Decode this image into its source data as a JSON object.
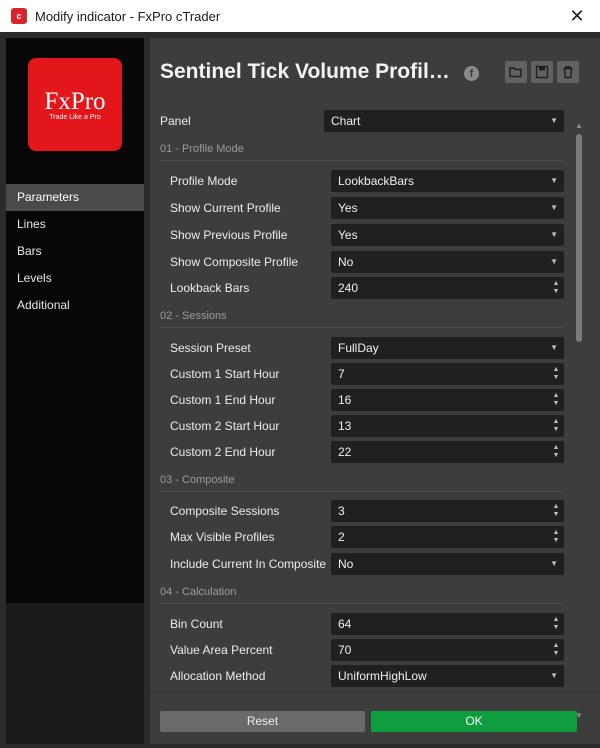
{
  "window": {
    "title": "Modify indicator - FxPro cTrader",
    "close_glyph": "✕"
  },
  "sidebar": {
    "logo_text": "FxPro",
    "logo_tagline": "Trade Like a Pro",
    "items": [
      {
        "label": "Parameters",
        "active": true
      },
      {
        "label": "Lines",
        "active": false
      },
      {
        "label": "Bars",
        "active": false
      },
      {
        "label": "Levels",
        "active": false
      },
      {
        "label": "Additional",
        "active": false
      }
    ]
  },
  "header": {
    "title": "Sentinel Tick Volume Profil…",
    "icons": [
      "facebook-icon",
      "open-folder-icon",
      "save-icon",
      "trash-icon"
    ]
  },
  "params": {
    "panel": {
      "label": "Panel",
      "value": "Chart"
    },
    "sections": [
      {
        "title": "01 - Profile Mode",
        "rows": [
          {
            "label": "Profile Mode",
            "value": "LookbackBars",
            "type": "select"
          },
          {
            "label": "Show Current Profile",
            "value": "Yes",
            "type": "select"
          },
          {
            "label": "Show Previous Profile",
            "value": "Yes",
            "type": "select"
          },
          {
            "label": "Show Composite Profile",
            "value": "No",
            "type": "select"
          },
          {
            "label": "Lookback Bars",
            "value": "240",
            "type": "number"
          }
        ]
      },
      {
        "title": "02 - Sessions",
        "rows": [
          {
            "label": "Session Preset",
            "value": "FullDay",
            "type": "select"
          },
          {
            "label": "Custom 1 Start Hour",
            "value": "7",
            "type": "number"
          },
          {
            "label": "Custom 1 End Hour",
            "value": "16",
            "type": "number"
          },
          {
            "label": "Custom 2 Start Hour",
            "value": "13",
            "type": "number"
          },
          {
            "label": "Custom 2 End Hour",
            "value": "22",
            "type": "number"
          }
        ]
      },
      {
        "title": "03 - Composite",
        "rows": [
          {
            "label": "Composite Sessions",
            "value": "3",
            "type": "number"
          },
          {
            "label": "Max Visible Profiles",
            "value": "2",
            "type": "number"
          },
          {
            "label": "Include Current In Composite",
            "value": "No",
            "type": "select"
          }
        ]
      },
      {
        "title": "04 - Calculation",
        "rows": [
          {
            "label": "Bin Count",
            "value": "64",
            "type": "number"
          },
          {
            "label": "Value Area Percent",
            "value": "70",
            "type": "number"
          },
          {
            "label": "Allocation Method",
            "value": "UniformHighLow",
            "type": "select"
          }
        ]
      }
    ]
  },
  "footer": {
    "reset_label": "Reset",
    "ok_label": "OK"
  },
  "colors": {
    "accent_ok": "#0f9d40",
    "brand_red": "#e2161b",
    "panel_bg": "#3d3d3d",
    "control_bg": "#202020"
  }
}
